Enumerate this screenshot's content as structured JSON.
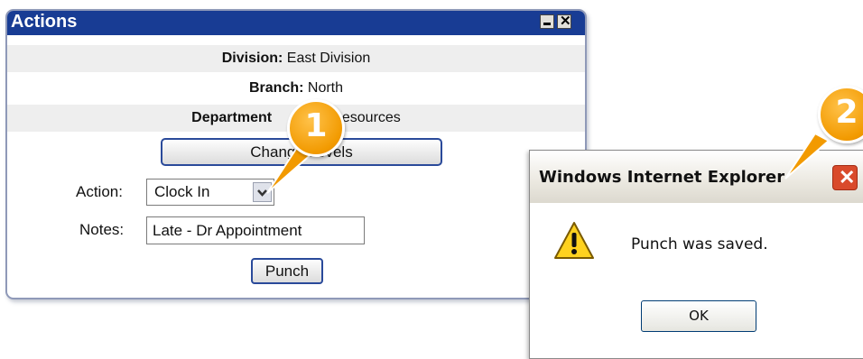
{
  "actions_panel": {
    "title": "Actions",
    "division_label": "Division:",
    "division_value": "East Division",
    "branch_label": "Branch:",
    "branch_value": "North",
    "department_label": "Department",
    "department_value": "n Resources",
    "change_levels_button": "Change Levels",
    "action_label": "Action:",
    "action_value": "Clock In",
    "notes_label": "Notes:",
    "notes_value": "Late - Dr Appointment",
    "punch_button": "Punch"
  },
  "dialog": {
    "title": "Windows Internet Explorer",
    "message": "Punch was saved.",
    "ok_button": "OK"
  },
  "callouts": [
    "1",
    "2"
  ],
  "colors": {
    "titlebar": "#183c94",
    "callout": "#f29a00"
  }
}
